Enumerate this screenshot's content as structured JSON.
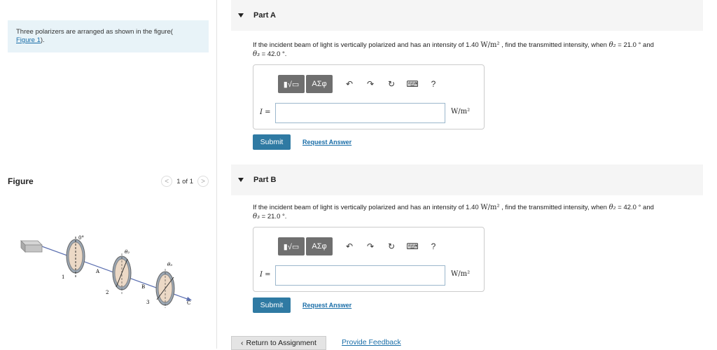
{
  "left": {
    "intro_text": "Three polarizers are arranged as shown in the figure(",
    "intro_link": "Figure 1",
    "intro_after": ").",
    "figure_title": "Figure",
    "pager_prev": "<",
    "pager_text": "1 of 1",
    "pager_next": ">",
    "figure_labels": {
      "angle0": "0°",
      "theta2": "θ₂",
      "theta3": "θ₃",
      "A": "A",
      "B": "B",
      "C": "C",
      "n1": "1",
      "n2": "2",
      "n3": "3"
    }
  },
  "partA": {
    "title": "Part A",
    "q_pre": "If the incident beam of light is vertically polarized and has an intensity of 1.40",
    "q_unit": "W/m²",
    "q_mid": ", find the transmitted intensity, when",
    "theta2_label": "θ₂",
    "theta2_val": "= 21.0 °",
    "and": "and",
    "theta3_label": "θ₃",
    "theta3_val": "= 42.0 °.",
    "var": "I =",
    "unit": "W/m²",
    "submit": "Submit",
    "request": "Request Answer"
  },
  "partB": {
    "title": "Part B",
    "q_pre": "If the incident beam of light is vertically polarized and has an intensity of 1.40",
    "q_unit": "W/m²",
    "q_mid": ", find the transmitted intensity, when",
    "theta2_label": "θ₂",
    "theta2_val": "= 42.0 °",
    "and": "and",
    "theta3_label": "θ₃",
    "theta3_val": "= 21.0 °.",
    "var": "I =",
    "unit": "W/m²",
    "submit": "Submit",
    "request": "Request Answer"
  },
  "toolbar": {
    "templates_icon": "▮√▭",
    "greek": "ΑΣφ",
    "undo": "↶",
    "redo": "↷",
    "reset": "↻",
    "keyboard": "⌨",
    "help": "?"
  },
  "footer": {
    "return": "Return to Assignment",
    "feedback": "Provide Feedback"
  }
}
